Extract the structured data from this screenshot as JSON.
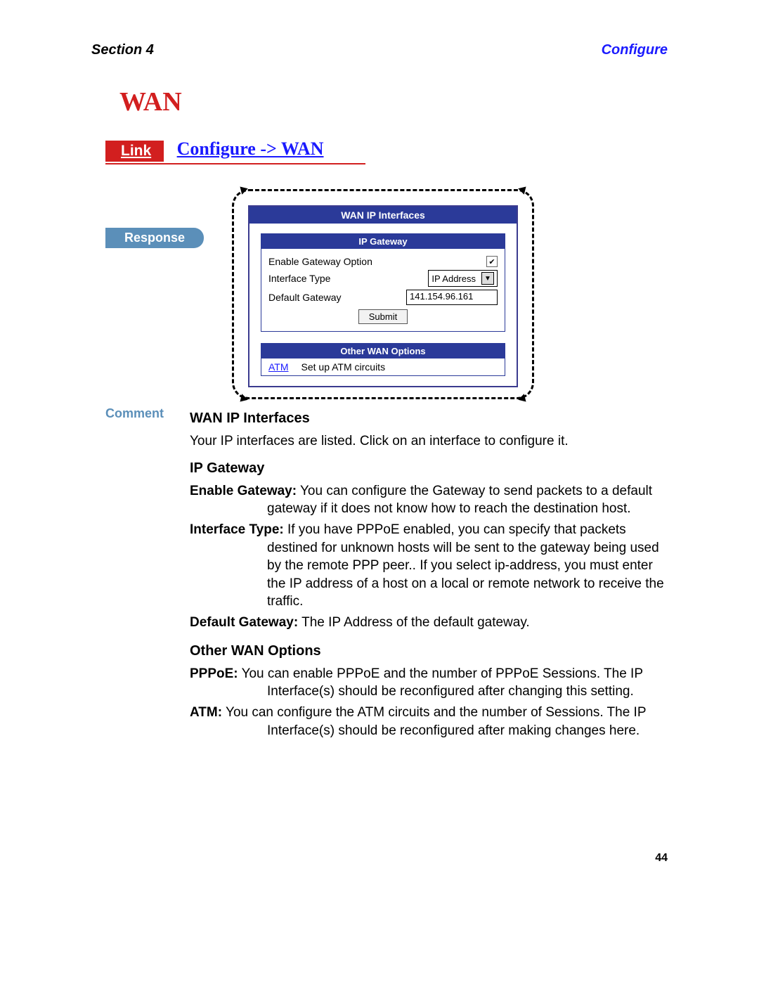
{
  "header": {
    "section": "Section 4",
    "chapter": "Configure"
  },
  "title": "WAN",
  "link_badge": "Link",
  "breadcrumb": "Configure -> WAN",
  "response_label": "Response",
  "comment_label": "Comment",
  "panel": {
    "title": "WAN IP Interfaces",
    "sub_title": "IP Gateway",
    "enable_label": "Enable Gateway Option",
    "enable_checked": true,
    "iface_label": "Interface Type",
    "iface_value": "IP Address",
    "gw_label": "Default Gateway",
    "gw_value": "141.154.96.161",
    "submit": "Submit",
    "other_title": "Other WAN Options",
    "other_link": "ATM",
    "other_text": "Set up ATM circuits"
  },
  "doc": {
    "h_wan": "WAN IP Interfaces",
    "p_wan": "Your IP interfaces are listed. Click on an interface to configure it.",
    "h_gw": "IP Gateway",
    "t_enable": "Enable Gateway:",
    "d_enable": "You can configure the Gateway to send packets to a default gateway if it does not know how to reach the destination host.",
    "t_iface": "Interface Type:",
    "d_iface": "If you have PPPoE enabled, you can specify that packets destined for unknown hosts will be sent to the gateway being used by the remote PPP peer.. If you select ip-address, you must enter the IP address of a host on a local or remote network to receive the traffic.",
    "t_defgw": "Default Gateway:",
    "d_defgw": "The IP Address of the default gateway.",
    "h_other": "Other WAN Options",
    "t_pppoe": "PPPoE:",
    "d_pppoe": "You can enable PPPoE and the number of PPPoE Sessions. The IP Interface(s) should be reconfigured after changing this setting.",
    "t_atm": "ATM:",
    "d_atm": "You can configure the ATM circuits and the number of Sessions. The IP Interface(s) should be reconfigured after making changes here."
  },
  "page_number": "44"
}
